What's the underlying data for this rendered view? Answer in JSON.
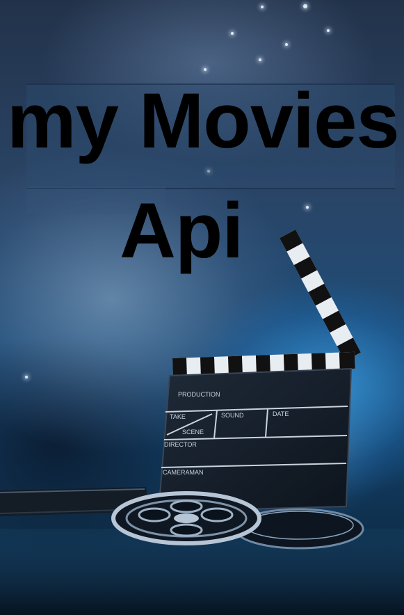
{
  "poster": {
    "title_line_1": "my Movies",
    "title_line_2": "Api"
  },
  "clapperboard": {
    "field_production": "PRODUCTION",
    "field_take": "TAKE",
    "field_sound": "SOUND",
    "field_date": "DATE",
    "field_scene": "SCENE",
    "field_director": "DIRECTOR",
    "field_cameraman": "CAMERAMAN"
  },
  "colors": {
    "accent_blue": "#2f8fd6",
    "title_text": "#000000"
  },
  "icons": [
    "clapperboard-icon",
    "film-reel-icon"
  ]
}
